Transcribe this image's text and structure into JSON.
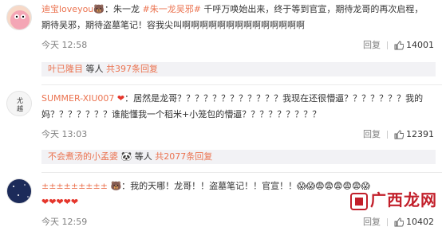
{
  "comments": [
    {
      "username": "迪宝loveyou",
      "badge": "🐻",
      "prefix": "：朱一龙",
      "hashtag": "#朱一龙吴邪#",
      "text_line1": "千呼万唤始出来，终于等到官宣，期待龙哥的再次启程，",
      "text_line2": "期待吴邪，期待盗墓笔记！容我尖叫啊啊啊啊啊啊啊啊啊啊啊啊啊啊",
      "time": "今天 12:58",
      "reply_label": "回复",
      "like_count": "14001",
      "reply_preview": {
        "name": "叶已隆目",
        "middle": "等人",
        "count": "共397条回复"
      }
    },
    {
      "username": "SUMMER-XIU007",
      "badge": "❤",
      "text_line1": "：居然是龙哥？？？？？？？？？？？？我现在还很懵逼？？？？？？？我的",
      "text_line2": "妈？？？？？？？谁能懂我一个稻米+小笼包的懵逼？？？？？？？？？",
      "time": "今天 13:03",
      "reply_label": "回复",
      "like_count": "12391",
      "reply_preview": {
        "name": "不会煮汤的小孟婆",
        "middle": "🐼 等人",
        "count": "共2077条回复"
      }
    },
    {
      "username": "±±±±±±±±±",
      "badge": "🐻",
      "text_line1": "：我的天哪！龙哥！！盗墓笔记！！官宣！！",
      "emojis": "😱😱😨😨😨😨😨😱",
      "hearts": "❤❤❤❤❤",
      "time": "今天 12:59",
      "reply_label": "回复",
      "like_count": "10402"
    }
  ],
  "watermark": "广西龙网"
}
